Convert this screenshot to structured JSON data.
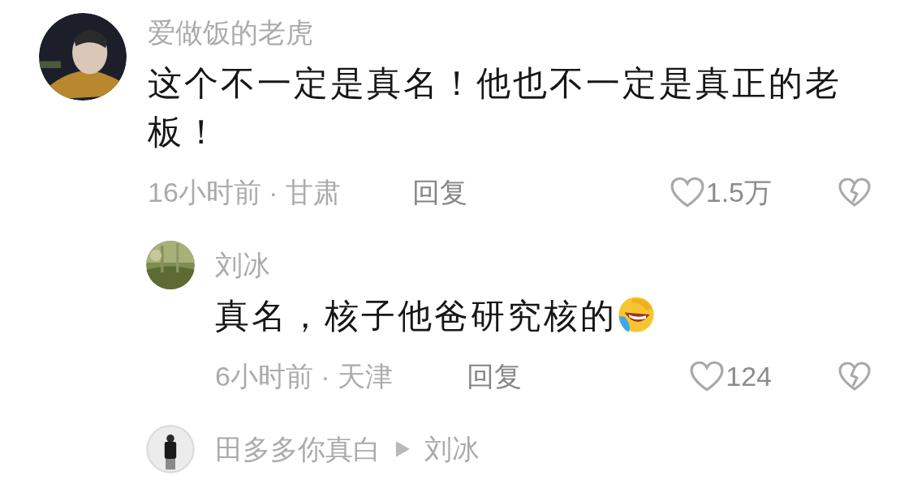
{
  "comments": [
    {
      "author": "爱做饭的老虎",
      "text": "这个不一定是真名！他也不一定是真正的老板！",
      "time_location": "16小时前 · 甘肃",
      "reply_label": "回复",
      "likes": "1.5万",
      "replies": [
        {
          "author": "刘冰",
          "text": "真名，核子他爸研究核的",
          "emoji": true,
          "time_location": "6小时前 · 天津",
          "reply_label": "回复",
          "likes": "124"
        },
        {
          "author": "田多多你真白",
          "reply_to": "刘冰"
        }
      ]
    }
  ]
}
